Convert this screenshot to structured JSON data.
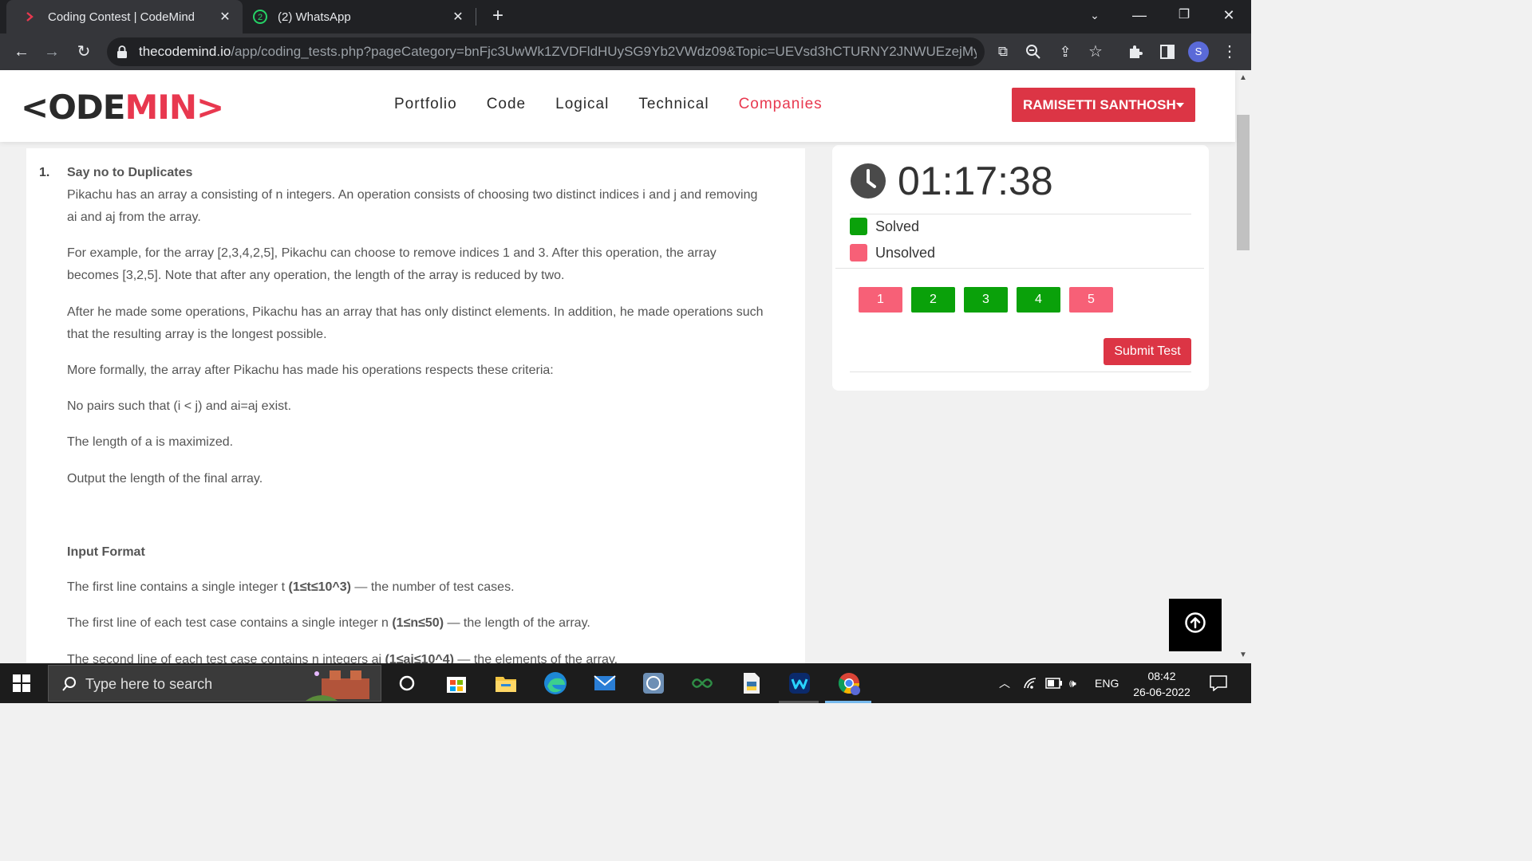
{
  "browser": {
    "tabs": [
      {
        "title": "Coding Contest | CodeMind",
        "active": true
      },
      {
        "title": "(2) WhatsApp",
        "badge": "2",
        "active": false
      }
    ],
    "url_host": "thecodemind.io",
    "url_path": "/app/coding_tests.php?pageCategory=bnFjc3UwWk1ZVDFldHUySG9Yb2VWdz09&Topic=UEVsd3hCTURNY2JNWUEzejMy...",
    "profile_initial": "S"
  },
  "site": {
    "logo_left": "<ODE",
    "logo_right": "MIN>",
    "nav": [
      "Portfolio",
      "Code",
      "Logical",
      "Technical",
      "Companies"
    ],
    "active_nav": "Companies",
    "user_name": "RAMISETTI SANTHOSH"
  },
  "problem": {
    "number": "1.",
    "title": "Say no to Duplicates",
    "p1": "Pikachu has an array a consisting of n integers. An operation consists of choosing two distinct indices i and j and removing ai and aj from the array.",
    "p2": "For example, for the array [2,3,4,2,5], Pikachu can choose to remove indices 1 and 3. After this operation, the array becomes [3,2,5]. Note that after any operation, the length of the array is reduced by two.",
    "p3": "After he made some operations, Pikachu has an array that has only distinct elements. In addition, he made operations such that the resulting array is the longest possible.",
    "p4": "More formally, the array after Pikachu has made his operations respects these criteria:",
    "p5": "No pairs such that (i < j) and ai=aj exist.",
    "p6": "The length of a is maximized.",
    "p7": "Output the length of the final array.",
    "input_heading": "Input Format",
    "in1_pre": "The first line contains a single integer t ",
    "in1_bold": "(1≤t≤10^3)",
    "in1_post": " — the number of test cases.",
    "in2_pre": "The first line of each test case contains a single integer n ",
    "in2_bold": "(1≤n≤50)",
    "in2_post": " — the length of the array.",
    "in3_pre": "The second line of each test case contains n integers ai ",
    "in3_bold": "(1≤ai≤10^4)",
    "in3_post": " — the elements of the array."
  },
  "sidebar": {
    "timer": "01:17:38",
    "legend_solved": "Solved",
    "legend_unsolved": "Unsolved",
    "questions": [
      {
        "label": "1",
        "status": "unsolved"
      },
      {
        "label": "2",
        "status": "solved"
      },
      {
        "label": "3",
        "status": "solved"
      },
      {
        "label": "4",
        "status": "solved"
      },
      {
        "label": "5",
        "status": "unsolved"
      }
    ],
    "submit_label": "Submit Test"
  },
  "colors": {
    "solved": "#0aa10a",
    "unsolved": "#f76077",
    "accent": "#dc3545"
  },
  "taskbar": {
    "search_placeholder": "Type here to search",
    "language": "ENG",
    "time": "08:42",
    "date": "26-06-2022"
  }
}
